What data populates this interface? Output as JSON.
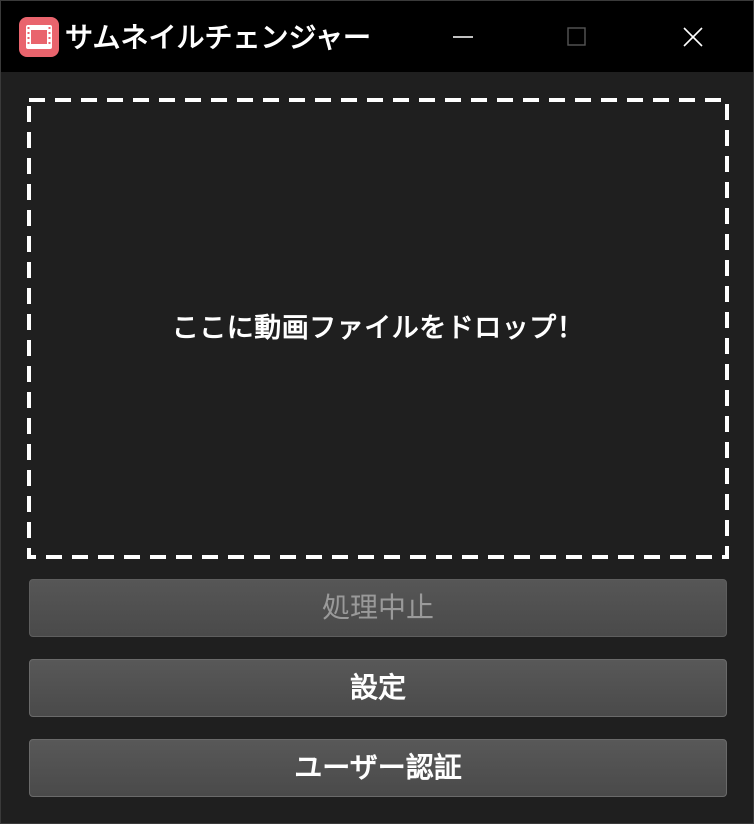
{
  "window": {
    "title": "サムネイルチェンジャー",
    "icon": "film-icon",
    "controls": {
      "minimize": "minimize-icon",
      "maximize": "maximize-icon",
      "close": "close-icon"
    }
  },
  "dropzone": {
    "text": "ここに動画ファイルをドロップ！"
  },
  "buttons": {
    "stop_label": "処理中止",
    "stop_enabled": false,
    "settings_label": "設定",
    "auth_label": "ユーザー認証"
  },
  "colors": {
    "titlebar": "#000000",
    "background": "#1f1f1f",
    "icon_accent": "#e9646d",
    "button": "#525252",
    "text": "#ffffff",
    "disabled_text": "#9a9a9a"
  }
}
